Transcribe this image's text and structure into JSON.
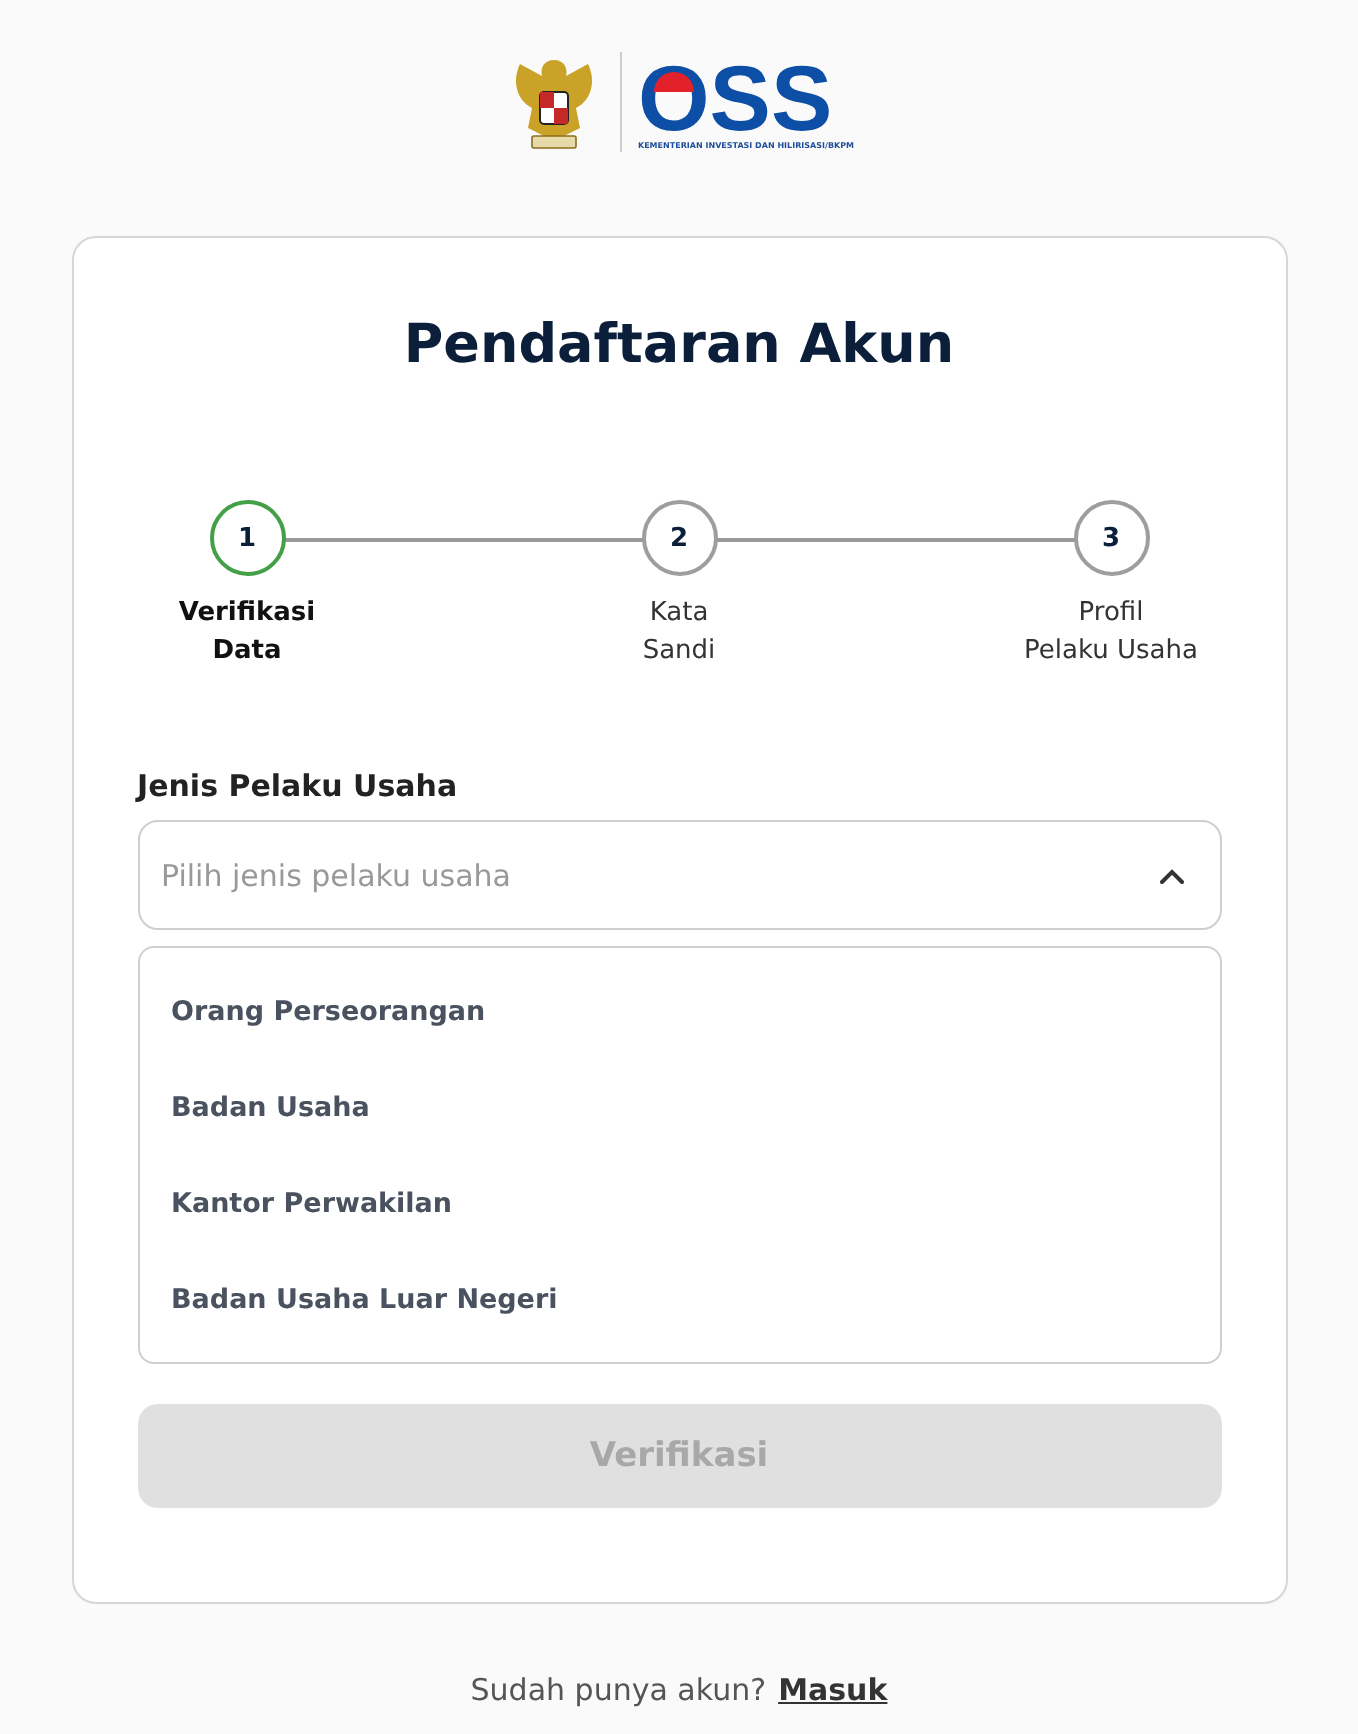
{
  "logo": {
    "wordmark": "OSS",
    "tagline": "KEMENTERIAN INVESTASI DAN HILIRISASI/BKPM"
  },
  "title": "Pendaftaran Akun",
  "steps": [
    {
      "number": "1",
      "label": "Verifikasi\nData",
      "selected": true
    },
    {
      "number": "2",
      "label": "Kata\nSandi",
      "selected": false
    },
    {
      "number": "3",
      "label": "Profil\nPelaku Usaha",
      "selected": false
    }
  ],
  "field": {
    "label": "Jenis Pelaku Usaha",
    "placeholder": "Pilih jenis pelaku usaha",
    "expanded": true,
    "options": [
      "Orang Perseorangan",
      "Badan Usaha",
      "Kantor Perwakilan",
      "Badan Usaha Luar Negeri"
    ]
  },
  "submit": {
    "label": "Verifikasi",
    "disabled": true
  },
  "footer": {
    "text": "Sudah punya akun?",
    "link": "Masuk"
  }
}
